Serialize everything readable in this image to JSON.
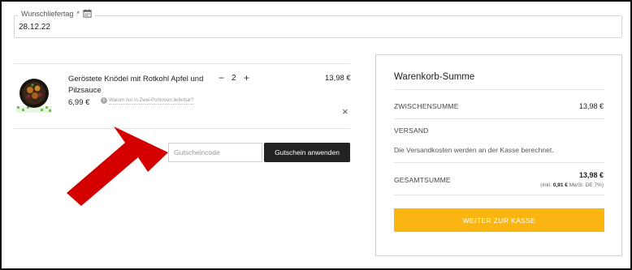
{
  "delivery": {
    "label": "Wunschliefertag",
    "required_mark": "*",
    "value": "28.12.22"
  },
  "cart_item": {
    "name": "Geröstete Knödel mit Rotkohl Apfel und Pilzsauce",
    "unit_price": "6,99 €",
    "portion_hint": "Warum nur in Zwei-Portionen lieferbar?",
    "info_icon": "i",
    "quantity": "2",
    "minus": "−",
    "plus": "+",
    "line_total": "13,98 €",
    "remove": "×"
  },
  "coupon": {
    "placeholder": "Gutscheincode",
    "button_label": "Gutschein anwenden"
  },
  "totals": {
    "title": "Warenkorb-Summe",
    "subtotal_label": "ZWISCHENSUMME",
    "subtotal_value": "13,98 €",
    "shipping_label": "VERSAND",
    "shipping_note": "Die Versandkosten werden an der Kasse berechnet.",
    "total_label": "GESAMTSUMME",
    "total_value": "13,98 €",
    "tax_prefix": "(inkl.",
    "tax_amount": "0,91 €",
    "tax_suffix": "MwSt. DE 7%)",
    "checkout_label": "WEITER ZUR KASSE"
  },
  "colors": {
    "checkout_button": "#fab511",
    "coupon_button": "#222222",
    "annotation_arrow": "#d40000"
  }
}
